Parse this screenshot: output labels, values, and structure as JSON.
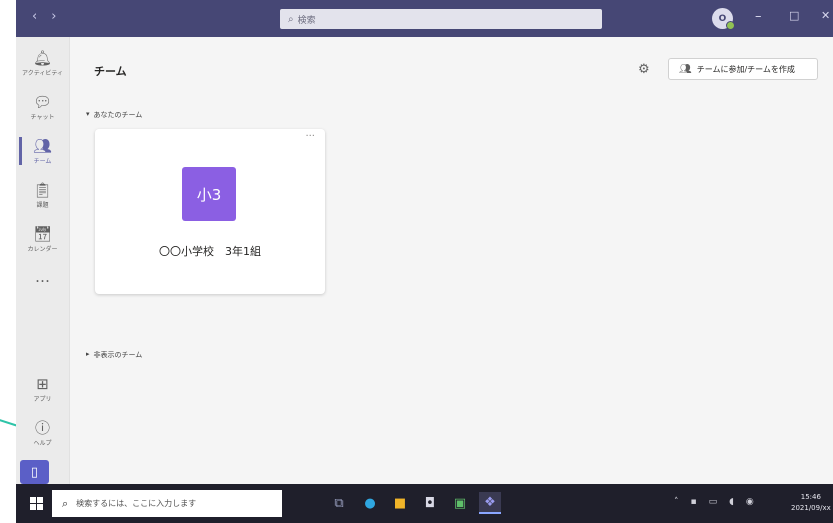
{
  "titlebar": {
    "nav_back": "‹",
    "nav_forward": "›",
    "search_placeholder": "検索",
    "avatar_initials": "O",
    "minimize": "–",
    "maximize": "□",
    "close": "✕"
  },
  "rail": {
    "items": [
      {
        "label": "アクティビティ",
        "icon": "bell-icon"
      },
      {
        "label": "チャット",
        "icon": "chat-icon"
      },
      {
        "label": "チーム",
        "icon": "teams-icon"
      },
      {
        "label": "課題",
        "icon": "assignments-icon"
      },
      {
        "label": "カレンダー",
        "icon": "calendar-icon"
      },
      {
        "label": "…",
        "icon": "more-icon"
      },
      {
        "label": "アプリ",
        "icon": "apps-icon"
      },
      {
        "label": "ヘルプ",
        "icon": "help-icon"
      }
    ],
    "active_index": 2
  },
  "main": {
    "title": "チーム",
    "join_button": "チームに参加/チームを作成",
    "your_teams_label": "あなたのチーム",
    "hidden_teams_label": "非表示のチーム",
    "team_card": {
      "tile_text": "小3",
      "tile_color": "#8b5fe3",
      "name": "〇〇小学校　3年1組",
      "more": "···"
    }
  },
  "taskbar": {
    "search_placeholder": "検索するには、ここに入力します",
    "time": "15:46",
    "date": "2021/09/xx"
  },
  "colors": {
    "titlebar": "#464775",
    "accent": "#6264a7",
    "taskbar": "#1f1f2b"
  }
}
